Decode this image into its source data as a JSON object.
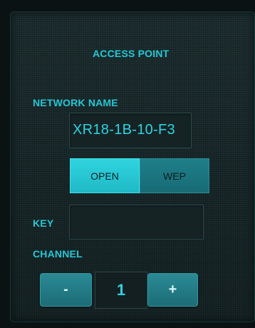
{
  "panel": {
    "title": "ACCESS POINT"
  },
  "network": {
    "label": "NETWORK NAME",
    "value": "XR18-1B-10-F3"
  },
  "security": {
    "options": [
      {
        "label": "OPEN",
        "selected": true
      },
      {
        "label": "WEP",
        "selected": false
      }
    ]
  },
  "key": {
    "label": "KEY",
    "value": ""
  },
  "channel": {
    "label": "CHANNEL",
    "value": "1",
    "decrement_label": "-",
    "increment_label": "+"
  },
  "colors": {
    "accent": "#23c8d6",
    "selected_segment": "#2fd4df",
    "unselected_segment": "#1f7f8a",
    "panel_background": "#1a2b2d"
  }
}
